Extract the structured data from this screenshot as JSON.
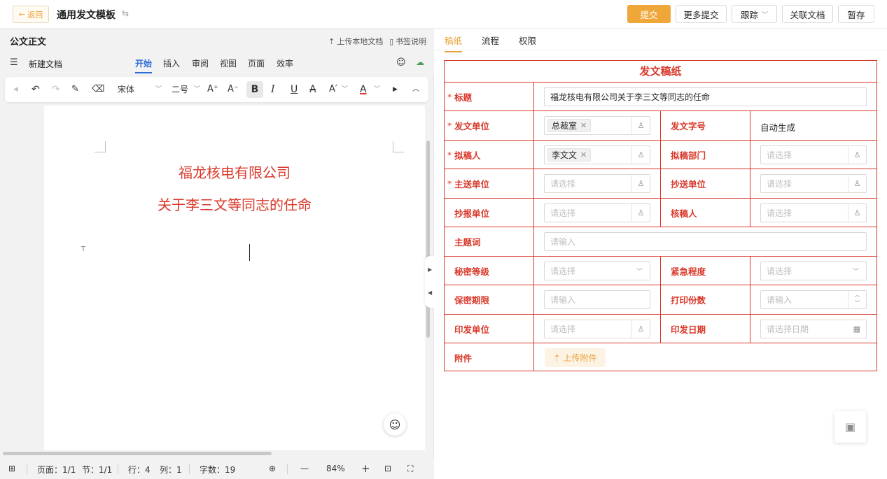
{
  "topbar": {
    "back_label": "返回",
    "title": "通用发文模板",
    "submit": "提交",
    "more_submit": "更多提交",
    "track": "跟踪",
    "linked_docs": "关联文档",
    "save_draft": "暂存"
  },
  "left": {
    "title": "公文正文",
    "upload_local": "上传本地文档",
    "bookmark_help": "书签说明",
    "doc_name": "新建文档",
    "menu_tabs": [
      "开始",
      "插入",
      "审阅",
      "视图",
      "页面",
      "效率"
    ],
    "ribbon": {
      "font": "宋体",
      "size": "二号"
    },
    "document": {
      "line1": "福龙核电有限公司",
      "line2": "关于李三文等同志的任命"
    },
    "status": {
      "page": "页面：1/1",
      "section": "节：1/1",
      "row": "行：4",
      "col": "列：1",
      "words": "字数：19",
      "zoom": "84%"
    }
  },
  "right": {
    "tabs": [
      "稿纸",
      "流程",
      "权限"
    ],
    "form_title": "发文稿纸",
    "fields": {
      "title_label": "标题",
      "title_value": "福龙核电有限公司关于李三文等同志的任命",
      "issuer_label": "发文单位",
      "issuer_tag": "总裁室",
      "doc_no_label": "发文字号",
      "doc_no_value": "自动生成",
      "drafter_label": "拟稿人",
      "drafter_tag": "李文文",
      "draft_dept_label": "拟稿部门",
      "main_to_label": "主送单位",
      "cc_label": "抄送单位",
      "report_to_label": "抄报单位",
      "verifier_label": "核稿人",
      "keywords_label": "主题词",
      "secret_label": "秘密等级",
      "urgency_label": "紧急程度",
      "secret_period_label": "保密期限",
      "copies_label": "打印份数",
      "print_unit_label": "印发单位",
      "print_date_label": "印发日期",
      "attach_label": "附件",
      "upload_attach": "上传附件"
    },
    "placeholders": {
      "select": "请选择",
      "input": "请输入",
      "date": "请选择日期"
    }
  }
}
